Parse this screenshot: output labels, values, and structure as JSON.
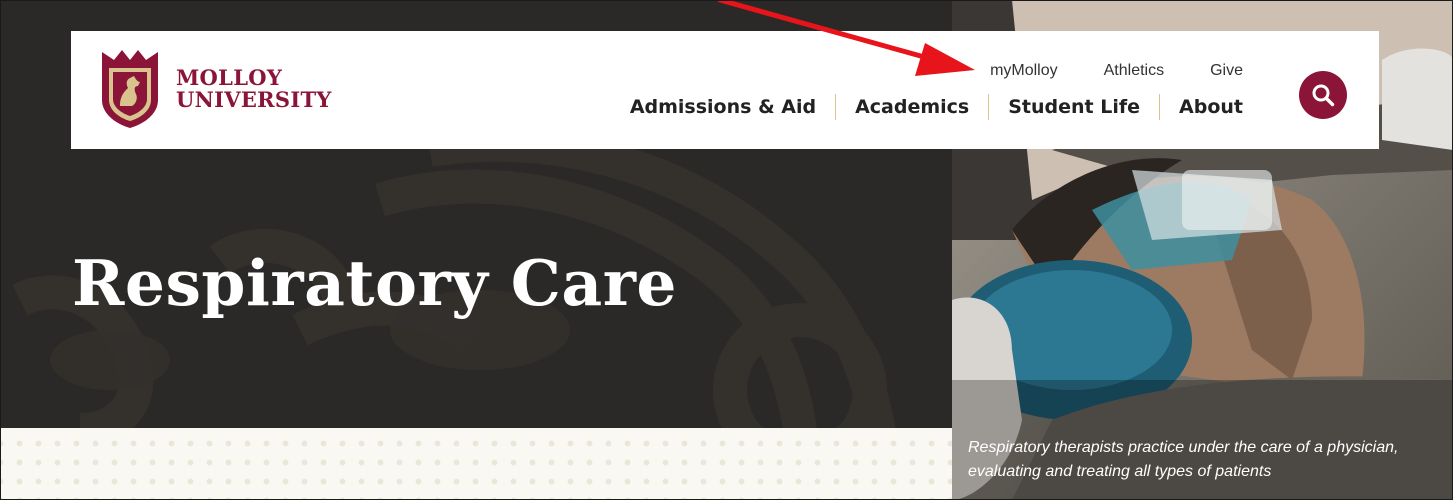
{
  "brand": {
    "name_line1": "MOLLOY",
    "name_line2": "UNIVERSITY",
    "color_maroon": "#8a1538",
    "color_gold": "#d8c48c"
  },
  "header": {
    "utility_links": [
      "myMolloy",
      "Athletics",
      "Give"
    ],
    "main_nav": [
      "Admissions & Aid",
      "Academics",
      "Student Life",
      "About"
    ],
    "search_icon": "search-icon"
  },
  "hero": {
    "title": "Respiratory Care",
    "caption": "Respiratory therapists practice under the care of a physician, evaluating and treating all types of patients"
  },
  "annotation": {
    "arrow_color": "#e8141b",
    "points_to": "myMolloy"
  }
}
